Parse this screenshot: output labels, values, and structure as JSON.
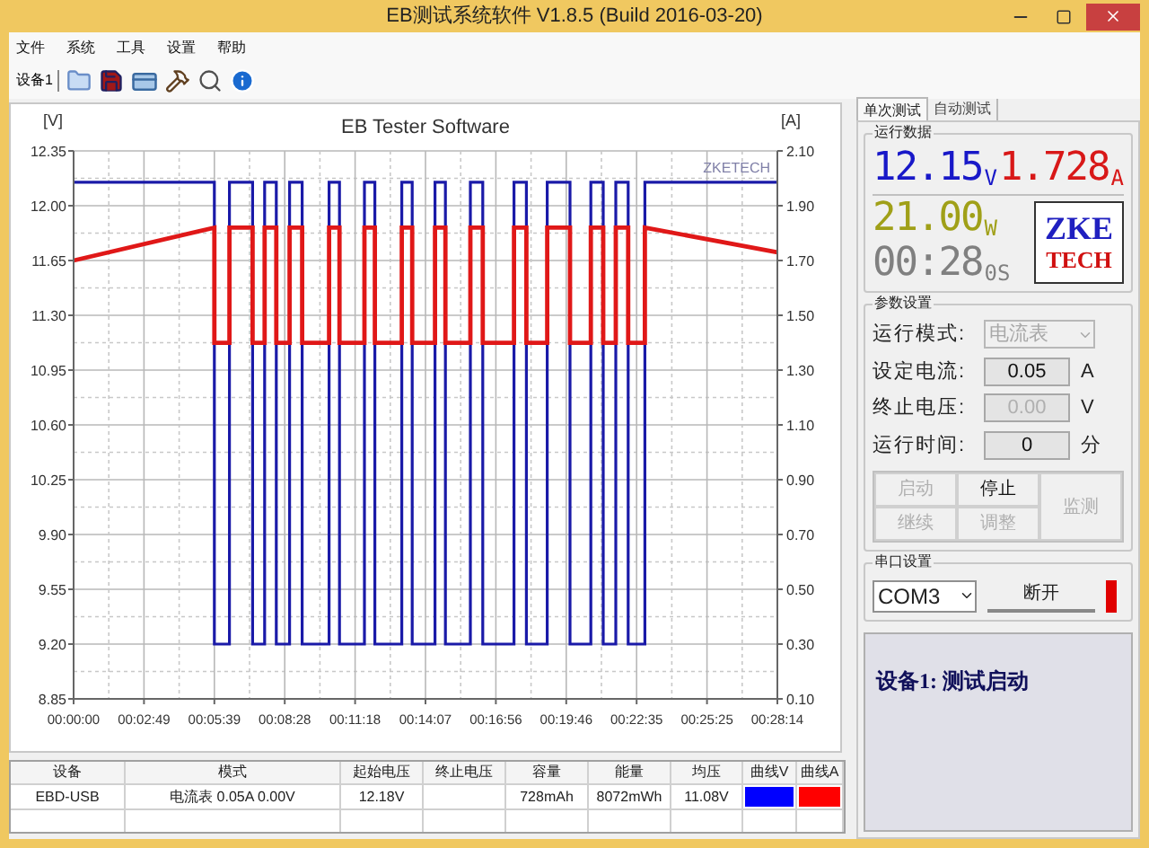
{
  "window": {
    "title": "EB测试系统软件 V1.8.5 (Build 2016-03-20)"
  },
  "menu": [
    "文件",
    "系统",
    "工具",
    "设置",
    "帮助"
  ],
  "toolbar": {
    "device": "设备1"
  },
  "chart": {
    "brand_label": "ZKETECH",
    "chart_data": {
      "type": "line",
      "title": "EB Tester Software",
      "ylabel": "[V]",
      "y2label": "[A]",
      "x": [
        0,
        339,
        339,
        375,
        375,
        431,
        431,
        460,
        460,
        488,
        488,
        520,
        520,
        550,
        550,
        615,
        615,
        640,
        640,
        700,
        700,
        725,
        725,
        790,
        790,
        815,
        815,
        870,
        870,
        895,
        895,
        955,
        955,
        985,
        985,
        1060,
        1060,
        1090,
        1090,
        1140,
        1140,
        1195,
        1195,
        1245,
        1245,
        1275,
        1275,
        1305,
        1305,
        1335,
        1335,
        1375,
        1375,
        1694
      ],
      "series": [
        {
          "color": "#1a1aa8",
          "axis": "y",
          "values": [
            12.15,
            12.15,
            9.2,
            9.2,
            12.15,
            12.15,
            9.2,
            9.2,
            12.15,
            12.15,
            9.2,
            9.2,
            12.15,
            12.15,
            9.2,
            9.2,
            12.15,
            12.15,
            9.2,
            9.2,
            12.15,
            12.15,
            9.2,
            9.2,
            12.15,
            12.15,
            9.2,
            9.2,
            12.15,
            12.15,
            9.2,
            9.2,
            12.15,
            12.15,
            9.2,
            9.2,
            12.15,
            12.15,
            9.2,
            9.2,
            12.15,
            12.15,
            9.2,
            9.2,
            12.15,
            12.15,
            9.2,
            9.2,
            12.15,
            12.15,
            9.2,
            9.2,
            12.15,
            12.15
          ]
        },
        {
          "color": "#e01818",
          "axis": "y2",
          "values": [
            1.7,
            1.82,
            1.4,
            1.4,
            1.82,
            1.82,
            1.4,
            1.4,
            1.82,
            1.82,
            1.4,
            1.4,
            1.82,
            1.82,
            1.4,
            1.4,
            1.82,
            1.82,
            1.4,
            1.4,
            1.82,
            1.82,
            1.4,
            1.4,
            1.82,
            1.82,
            1.4,
            1.4,
            1.82,
            1.82,
            1.4,
            1.4,
            1.82,
            1.82,
            1.4,
            1.4,
            1.82,
            1.82,
            1.4,
            1.4,
            1.82,
            1.82,
            1.4,
            1.4,
            1.82,
            1.82,
            1.4,
            1.4,
            1.82,
            1.82,
            1.4,
            1.4,
            1.82,
            1.73
          ]
        }
      ],
      "grid": true,
      "xlim": [
        0,
        1694
      ],
      "ylim": [
        8.85,
        12.35
      ],
      "y2lim": [
        0.1,
        2.1
      ],
      "xticks": [
        {
          "value": 0,
          "label": "00:00:00"
        },
        {
          "value": 169.4,
          "label": "00:02:49"
        },
        {
          "value": 338.8,
          "label": "00:05:39"
        },
        {
          "value": 508.2,
          "label": "00:08:28"
        },
        {
          "value": 677.6,
          "label": "00:11:18"
        },
        {
          "value": 847,
          "label": "00:14:07"
        },
        {
          "value": 1016.4,
          "label": "00:16:56"
        },
        {
          "value": 1185.8,
          "label": "00:19:46"
        },
        {
          "value": 1355.2,
          "label": "00:22:35"
        },
        {
          "value": 1524.6,
          "label": "00:25:25"
        },
        {
          "value": 1694,
          "label": "00:28:14"
        }
      ],
      "yticks": [
        {
          "value": 8.85,
          "label": "8.85"
        },
        {
          "value": 9.2,
          "label": "9.20"
        },
        {
          "value": 9.55,
          "label": "9.55"
        },
        {
          "value": 9.9,
          "label": "9.90"
        },
        {
          "value": 10.25,
          "label": "10.25"
        },
        {
          "value": 10.6,
          "label": "10.60"
        },
        {
          "value": 10.95,
          "label": "10.95"
        },
        {
          "value": 11.3,
          "label": "11.30"
        },
        {
          "value": 11.65,
          "label": "11.65"
        },
        {
          "value": 12,
          "label": "12.00"
        },
        {
          "value": 12.35,
          "label": "12.35"
        }
      ],
      "y2ticks": [
        {
          "value": 0.1,
          "label": "0.10"
        },
        {
          "value": 0.3,
          "label": "0.30"
        },
        {
          "value": 0.5,
          "label": "0.50"
        },
        {
          "value": 0.7,
          "label": "0.70"
        },
        {
          "value": 0.9,
          "label": "0.90"
        },
        {
          "value": 1.1,
          "label": "1.10"
        },
        {
          "value": 1.3,
          "label": "1.30"
        },
        {
          "value": 1.5,
          "label": "1.50"
        },
        {
          "value": 1.7,
          "label": "1.70"
        },
        {
          "value": 1.9,
          "label": "1.90"
        },
        {
          "value": 2.1,
          "label": "2.10"
        }
      ]
    }
  },
  "table": {
    "columns": [
      "设备",
      "模式",
      "起始电压",
      "终止电压",
      "容量",
      "能量",
      "均压",
      "曲线V",
      "曲线A"
    ],
    "rows": [
      {
        "cells": [
          {
            "kind": "text",
            "text": "EBD-USB"
          },
          {
            "kind": "text",
            "text": "电流表 0.05A 0.00V"
          },
          {
            "kind": "text",
            "text": "12.18V"
          },
          {
            "kind": "blank"
          },
          {
            "kind": "text",
            "text": "728mAh"
          },
          {
            "kind": "text",
            "text": "8072mWh"
          },
          {
            "kind": "text",
            "text": "11.08V"
          },
          {
            "kind": "color",
            "color": "#0000ff"
          },
          {
            "kind": "color",
            "color": "#ff0000"
          }
        ]
      }
    ]
  },
  "side_tabs": [
    {
      "label": "单次测试",
      "selected": true
    },
    {
      "label": "自动测试",
      "selected": false
    }
  ],
  "run_data": {
    "title": "运行数据",
    "readings": [
      {
        "value": "12.15",
        "unit": "V",
        "color": "#1818c8"
      },
      {
        "value": "1.728",
        "unit": "A",
        "color": "#d81818"
      },
      {
        "value": "21.00",
        "unit": "W",
        "color": "#a0a018"
      },
      {
        "value": "00:28",
        "unit": "0S",
        "color": "#808080"
      }
    ],
    "logo": {
      "top": "ZKE",
      "bottom": "TECH"
    }
  },
  "params": {
    "title": "参数设置",
    "fields": [
      {
        "label": "运行模式:",
        "kind": "select",
        "value": "电流表",
        "disabled": true
      },
      {
        "label": "设定电流:",
        "kind": "input",
        "value": "0.05",
        "unit": "A",
        "disabled": false
      },
      {
        "label": "终止电压:",
        "kind": "input",
        "value": "0.00",
        "unit": "V",
        "disabled": true
      },
      {
        "label": "运行时间:",
        "kind": "input",
        "value": "0",
        "unit": "分",
        "disabled": false
      }
    ],
    "buttons": [
      {
        "label": "启动",
        "kind": "normal",
        "disabled": true
      },
      {
        "label": "停止",
        "kind": "normal",
        "disabled": false
      },
      {
        "label": "监测",
        "kind": "tall",
        "disabled": true
      },
      {
        "label": "继续",
        "kind": "normal",
        "disabled": true
      },
      {
        "label": "调整",
        "kind": "normal",
        "disabled": true
      }
    ]
  },
  "serial": {
    "title": "串口设置",
    "port": "COM3",
    "button": "断开",
    "connected": true
  },
  "status": {
    "text": "设备1: 测试启动"
  }
}
